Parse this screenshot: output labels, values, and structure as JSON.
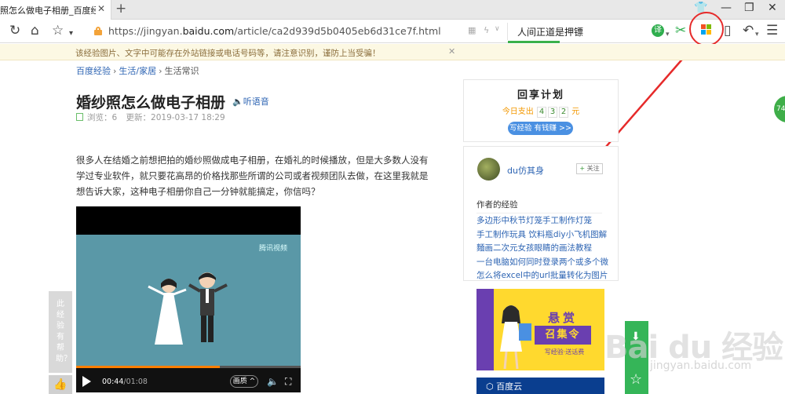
{
  "browser": {
    "tab_title": "照怎么做电子相册_百度经验",
    "tab_close": "✕",
    "new_tab": "+",
    "window_buttons": {
      "skin": "👕",
      "minimize": "—",
      "restore": "❐",
      "close": "✕"
    },
    "nav": {
      "refresh": "↻",
      "home": "⌂",
      "favorite": "☆",
      "favorite_more": "▾"
    },
    "url_prefix": "https://jingyan.",
    "url_domain": "baidu.com",
    "url_path": "/article/ca2d939d5b0405eb6d31ce7f.html",
    "search_text": "人间正道是押镖",
    "toolbar": {
      "ext_letter": "译",
      "cut": "✂",
      "reader": "▯",
      "undo": "↶",
      "menu": "☰"
    },
    "colors": {
      "accent": "#35b558",
      "highlight": "#e62a2a",
      "link": "#2d64b3"
    }
  },
  "notice": {
    "text": "该经验图片、文字中可能存在外站链接或电话号码等，请注意识别，谨防上当受骗！",
    "close": "✕"
  },
  "breadcrumb": [
    "百度经验",
    "生活/家居",
    "生活常识"
  ],
  "article": {
    "title": "婚纱照怎么做电子相册",
    "listen": "听语音",
    "views_label": "浏览：",
    "views": "6",
    "updated_label": "更新：",
    "updated": "2019-03-17 18:29",
    "intro": "很多人在结婚之前想把拍的婚纱照做成电子相册，在婚礼的时候播放，但是大多数人没有学过专业软件，就只要花高昂的价格找那些所谓的公司或者视频团队去做，在这里我就是想告诉大家，这种电子相册你自己一分钟就能搞定，你信吗？"
  },
  "video": {
    "brand": "腾讯视频",
    "current_time": "00:44",
    "duration": "01:08",
    "progress_percent": 64,
    "quality": "画质"
  },
  "helpful": {
    "text": "此经验有帮助？",
    "thumb": "👍"
  },
  "sidebar": {
    "plan": {
      "title": "回享计划",
      "today_label": "今日支出",
      "digits": [
        "4",
        "3",
        "2"
      ],
      "unit": "元",
      "button": "写经验 有钱赚 >>"
    },
    "author": {
      "name": "du仿其身",
      "follow": "关注",
      "exp_heading": "作者的经验",
      "experiences": [
        "多边形中秋节灯笼手工制作灯笼",
        "手工制作玩具 饮料瓶diy小飞机图解",
        "麵画二次元女孩眼睛的画法教程",
        "一台电脑如何同时登录两个或多个微",
        "怎么将excel中的url批量转化为图片"
      ]
    },
    "banner": {
      "line1": "悬赏",
      "line2": "召集令",
      "line3": "写经验·送话费"
    },
    "banner2": "百度云"
  },
  "right_edge": "74",
  "watermark": {
    "main": "Bai du 经验",
    "sub": "jingyan.baidu.com"
  }
}
